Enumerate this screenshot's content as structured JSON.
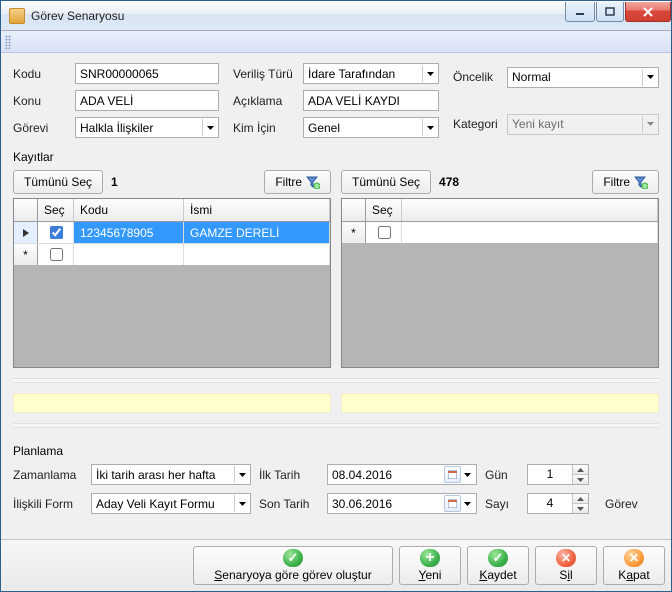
{
  "window": {
    "title": "Görev Senaryosu"
  },
  "form": {
    "kodu_label": "Kodu",
    "kodu": "SNR00000065",
    "konu_label": "Konu",
    "konu": "ADA VELİ",
    "gorevi_label": "Görevi",
    "gorevi": "Halkla İlişkiler",
    "verilis_label": "Veriliş Türü",
    "verilis": "İdare Tarafından",
    "aciklama_label": "Açıklama",
    "aciklama": "ADA VELİ KAYDI",
    "kimicin_label": "Kim İçin",
    "kimicin": "Genel",
    "oncelik_label": "Öncelik",
    "oncelik": "Normal",
    "kategori_label": "Kategori",
    "kategori": "Yeni kayıt"
  },
  "records": {
    "label": "Kayıtlar",
    "select_all": "Tümünü Seç",
    "filter": "Filtre",
    "left": {
      "count": "1",
      "columns": {
        "sec": "Seç",
        "kodu": "Kodu",
        "ismi": "İsmi"
      },
      "rows": [
        {
          "checked": true,
          "kodu": "12345678905",
          "ismi": "GAMZE DERELİ"
        }
      ]
    },
    "right": {
      "count": "478",
      "columns": {
        "sec": "Seç"
      }
    }
  },
  "plan": {
    "label": "Planlama",
    "zaman_label": "Zamanlama",
    "zaman": "İki tarih arası her hafta",
    "form_label": "İlişkili Form",
    "form": "Aday Veli Kayıt Formu",
    "ilk_label": "İlk Tarih",
    "ilk": "08.04.2016",
    "son_label": "Son Tarih",
    "son": "30.06.2016",
    "gun_label": "Gün",
    "gun": "1",
    "sayi_label": "Sayı",
    "sayi": "4",
    "gorev_label": "Görev"
  },
  "footer": {
    "create": "Senaryoya göre görev oluştur",
    "yeni": "Yeni",
    "kaydet": "Kaydet",
    "sil": "Sil",
    "kapat": "Kapat"
  }
}
